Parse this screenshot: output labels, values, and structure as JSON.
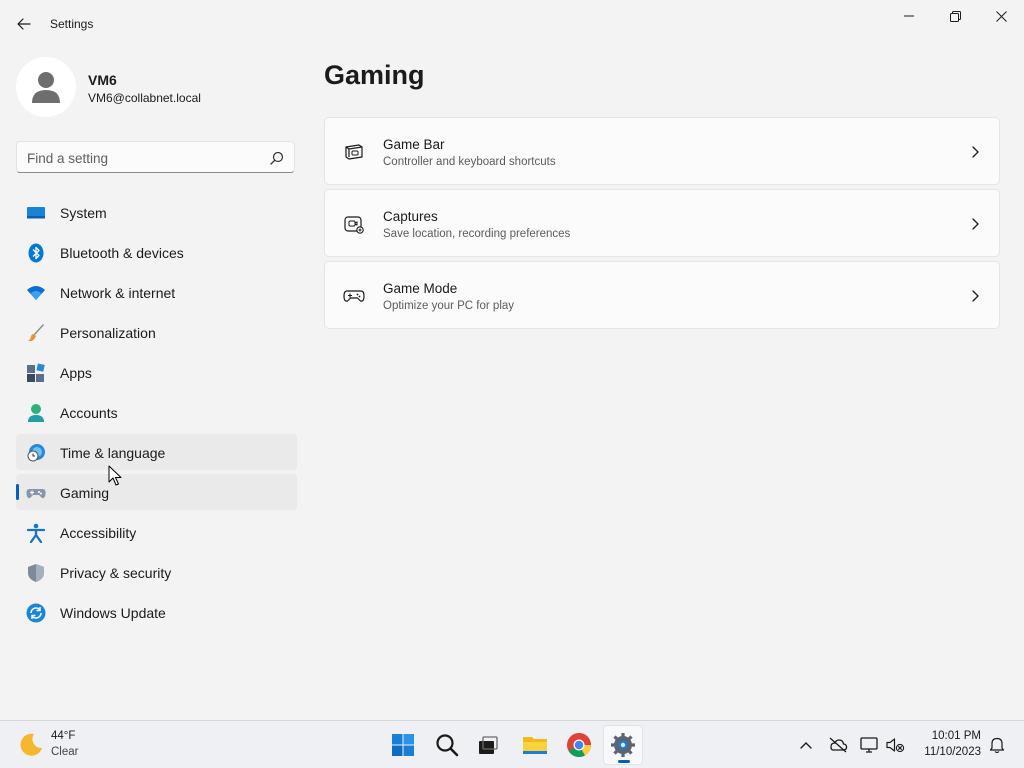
{
  "window": {
    "title": "Settings",
    "controls": [
      "minimize",
      "maximize",
      "close"
    ]
  },
  "profile": {
    "name": "VM6",
    "email": "VM6@collabnet.local"
  },
  "search": {
    "placeholder": "Find a setting",
    "value": ""
  },
  "nav": {
    "items": [
      {
        "label": "System",
        "icon": "system-icon"
      },
      {
        "label": "Bluetooth & devices",
        "icon": "bluetooth-icon"
      },
      {
        "label": "Network & internet",
        "icon": "wifi-icon"
      },
      {
        "label": "Personalization",
        "icon": "brush-icon"
      },
      {
        "label": "Apps",
        "icon": "apps-icon"
      },
      {
        "label": "Accounts",
        "icon": "accounts-icon"
      },
      {
        "label": "Time & language",
        "icon": "globe-clock-icon",
        "state": "hover"
      },
      {
        "label": "Gaming",
        "icon": "gamepad-icon",
        "state": "selected"
      },
      {
        "label": "Accessibility",
        "icon": "accessibility-icon"
      },
      {
        "label": "Privacy & security",
        "icon": "shield-icon"
      },
      {
        "label": "Windows Update",
        "icon": "update-icon"
      }
    ]
  },
  "main": {
    "title": "Gaming",
    "cards": [
      {
        "title": "Game Bar",
        "description": "Controller and keyboard shortcuts",
        "icon": "game-bar-icon"
      },
      {
        "title": "Captures",
        "description": "Save location, recording preferences",
        "icon": "capture-icon"
      },
      {
        "title": "Game Mode",
        "description": "Optimize your PC for play",
        "icon": "game-mode-icon"
      }
    ]
  },
  "taskbar": {
    "weather": {
      "temp": "44°F",
      "condition": "Clear",
      "icon": "moon-icon"
    },
    "apps": [
      {
        "name": "start",
        "icon": "windows-logo-icon"
      },
      {
        "name": "search",
        "icon": "search-icon"
      },
      {
        "name": "task-view",
        "icon": "task-view-icon"
      },
      {
        "name": "file-explorer",
        "icon": "folder-icon"
      },
      {
        "name": "chrome",
        "icon": "chrome-icon"
      },
      {
        "name": "settings",
        "icon": "gear-icon",
        "active": true
      }
    ],
    "tray": [
      "chevron-up-icon",
      "cloud-off-icon",
      "network-icon",
      "speaker-muted-icon"
    ],
    "clock": {
      "time": "10:01 PM",
      "date": "11/10/2023"
    }
  },
  "colors": {
    "accent": "#005fb8",
    "background": "#f3f3f3",
    "card": "#fbfbfb",
    "hover": "#eaeaea"
  }
}
